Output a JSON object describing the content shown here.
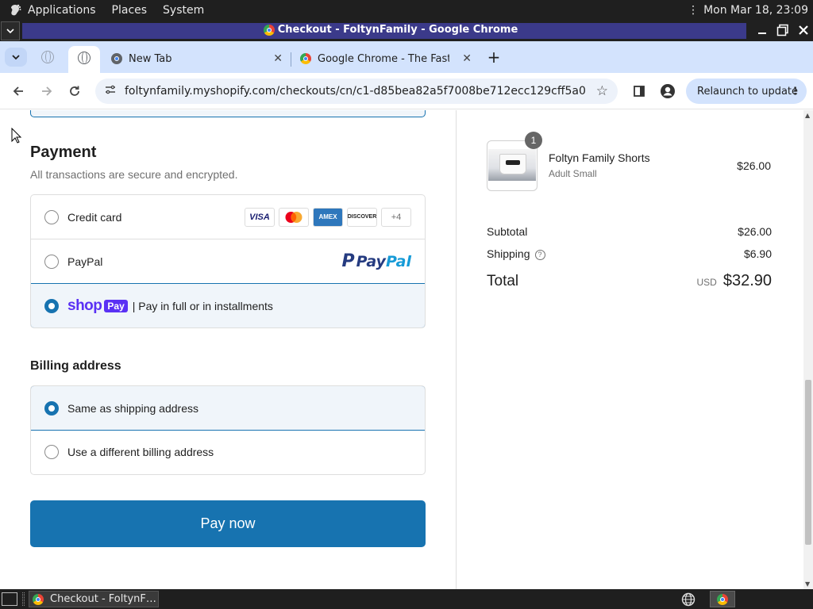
{
  "system": {
    "menus": [
      "Applications",
      "Places",
      "System"
    ],
    "clock": "Mon Mar 18, 23:09"
  },
  "window": {
    "title": "Checkout - FoltynFamily - Google Chrome"
  },
  "tabs": [
    {
      "label": "New Tab"
    },
    {
      "label": "Google Chrome - The Fast &"
    }
  ],
  "toolbar": {
    "url": "foltynfamily.myshopify.com/checkouts/cn/c1-d85bea82a5f7008be712ecc129cff5a0",
    "relaunch_label": "Relaunch to update"
  },
  "payment": {
    "heading": "Payment",
    "subtext": "All transactions are secure and encrypted.",
    "options": [
      {
        "label": "Credit card",
        "selected": false
      },
      {
        "label": "PayPal",
        "selected": false
      },
      {
        "label": "| Pay in full or in installments",
        "selected": true
      }
    ],
    "card_brands": [
      "VISA",
      "AMEX",
      "DISCOVER"
    ],
    "more_cards": "+4",
    "paypal_logo": {
      "pay": "Pay",
      "pal": "Pal"
    },
    "shoppay": {
      "shop": "shop",
      "pay": "Pay"
    }
  },
  "billing": {
    "heading": "Billing address",
    "options": [
      {
        "label": "Same as shipping address",
        "selected": true
      },
      {
        "label": "Use a different billing address",
        "selected": false
      }
    ]
  },
  "pay_button": "Pay now",
  "summary": {
    "item": {
      "name": "Foltyn Family Shorts",
      "variant": "Adult Small",
      "price": "$26.00",
      "quantity": "1"
    },
    "subtotal_label": "Subtotal",
    "subtotal": "$26.00",
    "shipping_label": "Shipping",
    "shipping": "$6.90",
    "total_label": "Total",
    "currency": "USD",
    "total": "$32.90"
  },
  "taskbar": {
    "task_label": "Checkout - FoltynF…"
  },
  "colors": {
    "accent": "#1773b0",
    "shop_purple": "#5a31f4",
    "selected_bg": "#f0f5fa"
  }
}
